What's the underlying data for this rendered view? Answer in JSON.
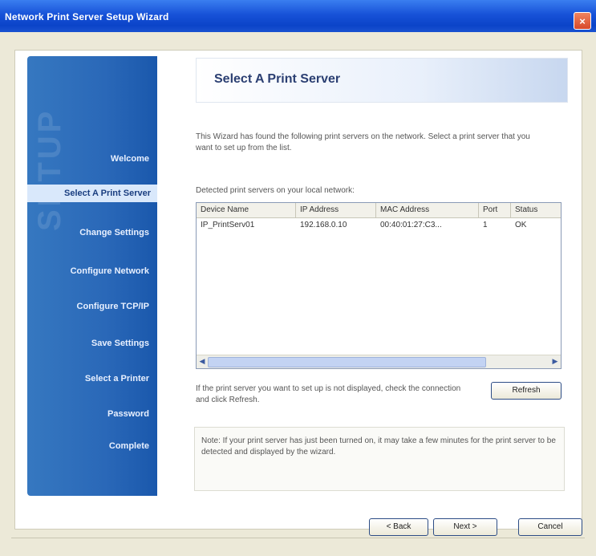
{
  "window": {
    "title": "Network Print Server Setup Wizard",
    "close_glyph": "×"
  },
  "sidebar": {
    "watermark": "SETUP",
    "items": [
      {
        "label": "Welcome",
        "active": false
      },
      {
        "label": "Select A Print Server",
        "active": true
      },
      {
        "label": "Change Settings",
        "active": false
      },
      {
        "label": "Configure Network",
        "active": false
      },
      {
        "label": "Configure TCP/IP",
        "active": false
      },
      {
        "label": "Save Settings",
        "active": false
      },
      {
        "label": "Select a Printer",
        "active": false
      },
      {
        "label": "Password",
        "active": false
      },
      {
        "label": "Complete",
        "active": false
      }
    ]
  },
  "main": {
    "heading": "Select A Print Server",
    "intro": "This Wizard has found the following print servers on the network. Select a print server that you want to set up from the list.",
    "list_label": "Detected print servers on your local network:",
    "columns": [
      "Device Name",
      "IP Address",
      "MAC Address",
      "Port",
      "Status"
    ],
    "rows": [
      [
        "IP_PrintServ01",
        "192.168.0.10",
        "00:40:01:27:C3...",
        "1",
        "OK"
      ]
    ],
    "refresh_hint": "If the print server you want to set up is not displayed, check the connection and click Refresh.",
    "refresh_label": "Refresh",
    "note": "Note: If your print server has just been turned on, it may take a few minutes for the print server to be detected and displayed by the wizard."
  },
  "nav": {
    "back": "< Back",
    "next": "Next >",
    "cancel": "Cancel"
  },
  "colors": {
    "titlebar": "#1752d8",
    "sidebar": "#2a68b8",
    "heading": "#2b3f72",
    "background": "#ece9d8"
  }
}
